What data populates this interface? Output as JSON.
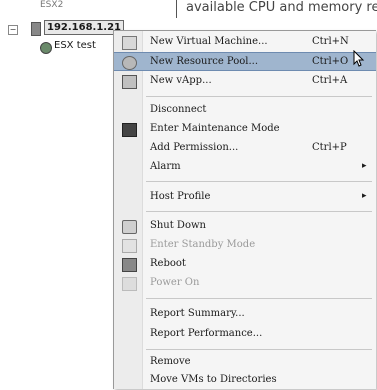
{
  "tree": {
    "top_cut_label": "ESX2",
    "expander": "−",
    "host_label": "192.168.1.21",
    "vm_label": "ESX test"
  },
  "content": {
    "text": "available CPU and memory res"
  },
  "menu": {
    "items": [
      {
        "label": "New Virtual Machine...",
        "shortcut": "Ctrl+N",
        "icon": "new-vm-icon"
      },
      {
        "label": "New Resource Pool...",
        "shortcut": "Ctrl+O",
        "icon": "resource-pool-icon"
      },
      {
        "label": "New vApp...",
        "shortcut": "Ctrl+A",
        "icon": "vapp-icon"
      },
      {
        "label": "Disconnect"
      },
      {
        "label": "Enter Maintenance Mode",
        "icon": "maintenance-icon"
      },
      {
        "label": "Add Permission...",
        "shortcut": "Ctrl+P"
      },
      {
        "label": "Alarm",
        "submenu": "▸"
      },
      {
        "label": "Host Profile",
        "submenu": "▸"
      },
      {
        "label": "Shut Down",
        "icon": "shutdown-icon"
      },
      {
        "label": "Enter Standby Mode",
        "icon": "standby-icon",
        "disabled": true
      },
      {
        "label": "Reboot",
        "icon": "reboot-icon"
      },
      {
        "label": "Power On",
        "icon": "power-on-icon",
        "disabled": true
      },
      {
        "label": "Report Summary..."
      },
      {
        "label": "Report Performance..."
      },
      {
        "label": "Remove"
      },
      {
        "label": "Move VMs to Directories"
      }
    ],
    "highlighted": "New Resource Pool..."
  }
}
